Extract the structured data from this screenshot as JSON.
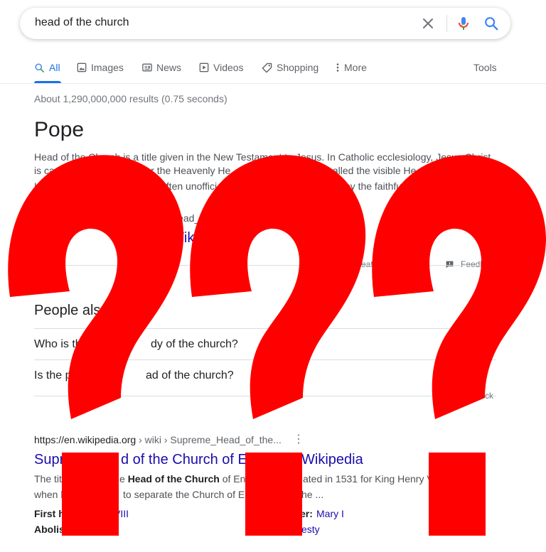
{
  "search": {
    "query": "head of the church"
  },
  "tabs": [
    {
      "label": "All",
      "icon": "search-icon"
    },
    {
      "label": "Images",
      "icon": "image-icon"
    },
    {
      "label": "News",
      "icon": "news-icon"
    },
    {
      "label": "Videos",
      "icon": "video-icon"
    },
    {
      "label": "Shopping",
      "icon": "tag-icon"
    },
    {
      "label": "More",
      "icon": "more-vert-icon"
    }
  ],
  "tools_label": "Tools",
  "stats": "About 1,290,000,000 results (0.75 seconds)",
  "knowledge_panel": {
    "title": "Pope",
    "snippet_line1": "Head of the Church is a title given in the New Testament to Jesus. In Catholic ecclesiology, Jesus Christ",
    "snippet_line2a": "is ca",
    "snippet_line2b": "ad or the Heavenly He",
    "snippet_line2c": "s called the visible He",
    "snippet_line3a": "H",
    "snippet_line3b": "is often unoffici",
    "snippet_line3c": "ist by the faithful",
    "url_fragment": "Head_of",
    "link_fragment": "Wikip",
    "about_fragment": "eatu",
    "feedback": "Feedb"
  },
  "people_also_ask": {
    "title": "People als",
    "questions": [
      {
        "a": "Who is th",
        "b": "dy of the church?"
      },
      {
        "a": "Is the p",
        "b": "ad of the church?"
      }
    ],
    "feedback": "ck"
  },
  "result": {
    "url_domain": "https://en.wikipedia.org",
    "url_path": " › wiki › Supreme_Head_of_the...",
    "title_a": "Supr",
    "title_b": "d of the Church of E",
    "title_c": "Wikipedia",
    "snip1_a": "The tit",
    "snip1_b": "e ",
    "snip1_bold": "Head of the Church",
    "snip1_c": " of Engl",
    "snip1_d": "ated in 1531 for King Henry VI",
    "snip2_a": "when h",
    "snip2_b": "to separate the Church of E",
    "snip2_c": "he ...",
    "kv1_label": "First h",
    "kv1_value": "VIII",
    "kv2_label": "er:",
    "kv2_value": "Mary I",
    "kv3_label": "Abolis",
    "kv4_value": "esty"
  },
  "colors": {
    "overlay_red": "#ff0000",
    "link_blue": "#1a0dab",
    "accent_blue": "#1a73e8"
  }
}
